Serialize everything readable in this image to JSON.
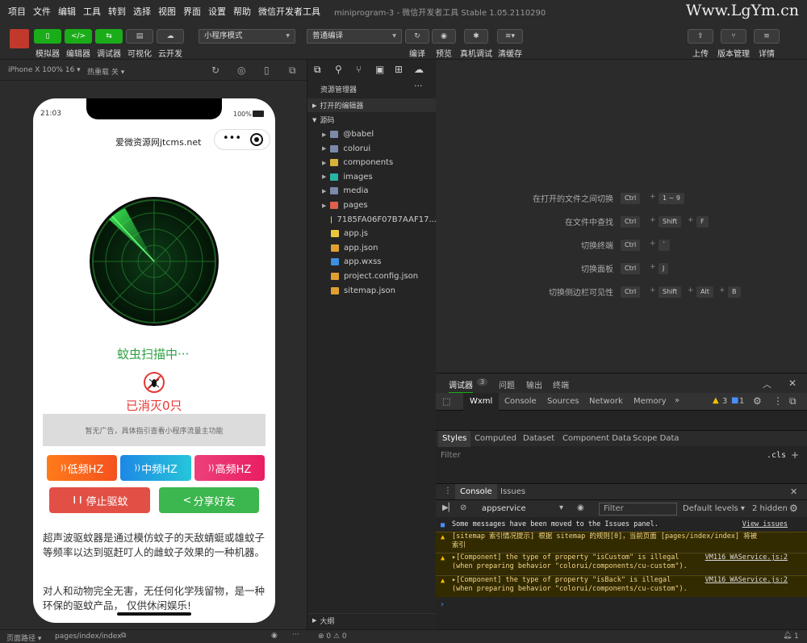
{
  "menu": [
    "项目",
    "文件",
    "编辑",
    "工具",
    "转到",
    "选择",
    "视图",
    "界面",
    "设置",
    "帮助",
    "微信开发者工具"
  ],
  "window_title": "miniprogram-3 - 微信开发者工具 Stable 1.05.2110290",
  "watermark": "Www.LgYm.cn",
  "toolbar": {
    "simulator": "模拟器",
    "editor": "编辑器",
    "debugger": "调试器",
    "visual": "可视化",
    "cloud": "云开发",
    "mode_select": "小程序模式",
    "compile_select": "普通编译",
    "compile": "编译",
    "preview": "预览",
    "real_debug": "真机调试",
    "clear_cache": "清缓存",
    "upload": "上传",
    "version": "版本管理",
    "details": "详情"
  },
  "simbar": {
    "device": "iPhone X 100% 16 ▾",
    "hot_reload": "热重载 关 ▾"
  },
  "phone": {
    "time": "21:03",
    "battery": "100%",
    "nav_title": "爱微资源网jtcms.net",
    "scan_text": "蚊虫扫描中···",
    "killed": "已消灭0只",
    "ad_text": "暂无广告，具体指引查看小程序流量主功能",
    "btn_low": "低频HZ",
    "btn_mid": "中频HZ",
    "btn_high": "高频HZ",
    "btn_stop": "停止驱蚊",
    "btn_share": "分享好友",
    "desc1": "超声波驱蚊器是通过模仿蚊子的天敌蜻蜓或雄蚊子等频率以达到驱赶叮人的雌蚊子效果的一种机器。",
    "desc2": "对人和动物完全无害，无任何化学残留物，是一种环保的驱蚊产品，  仅供休闲娱乐!"
  },
  "explorer": {
    "title": "资源管理器",
    "open_editors": "打开的编辑器",
    "source": "源码",
    "outline": "大纲",
    "items": [
      {
        "name": "@babel",
        "type": "folder"
      },
      {
        "name": "colorui",
        "type": "folder"
      },
      {
        "name": "components",
        "type": "folder-yellow"
      },
      {
        "name": "images",
        "type": "folder-teal"
      },
      {
        "name": "media",
        "type": "folder"
      },
      {
        "name": "pages",
        "type": "folder-red"
      },
      {
        "name": "7185FA06F07B7AAF17...",
        "type": "js"
      },
      {
        "name": "app.js",
        "type": "js"
      },
      {
        "name": "app.json",
        "type": "json"
      },
      {
        "name": "app.wxss",
        "type": "wxss"
      },
      {
        "name": "project.config.json",
        "type": "json"
      },
      {
        "name": "sitemap.json",
        "type": "json"
      }
    ]
  },
  "shortcuts": [
    {
      "label": "在打开的文件之间切换",
      "keys": [
        "Ctrl",
        "1 ~ 9"
      ]
    },
    {
      "label": "在文件中查找",
      "keys": [
        "Ctrl",
        "Shift",
        "F"
      ]
    },
    {
      "label": "切换终端",
      "keys": [
        "Ctrl",
        "`"
      ]
    },
    {
      "label": "切换面板",
      "keys": [
        "Ctrl",
        "J"
      ]
    },
    {
      "label": "切换侧边栏可见性",
      "keys": [
        "Ctrl",
        "Shift",
        "Alt",
        "B"
      ]
    }
  ],
  "debug": {
    "tabs_top": {
      "debugger": "调试器",
      "count": "3",
      "issues": "问题",
      "output": "输出",
      "terminal": "终端"
    },
    "tabs": [
      "Wxml",
      "Console",
      "Sources",
      "Network",
      "Memory"
    ],
    "warn_count": "3",
    "info_count": "1",
    "subtabs": [
      "Styles",
      "Computed",
      "Dataset",
      "Component Data",
      "Scope Data"
    ],
    "filter": "Filter",
    "cls": ".cls",
    "drawer_tabs": [
      "Console",
      "Issues"
    ],
    "context": "appservice",
    "filter2": "Filter",
    "levels": "Default levels ▾",
    "hidden": "2 hidden",
    "messages": [
      {
        "text": "Some messages have been moved to the Issues panel.",
        "link": "View issues",
        "kind": "info"
      },
      {
        "text": "[sitemap 索引情况提示] 根据 sitemap 的规则[0]，当前页面 [pages/index/index] 将被索引",
        "link": "",
        "kind": "warn"
      },
      {
        "text": "▸[Component] the type of property \"isCustom\" is illegal (when preparing behavior \"colorui/components/cu-custom\").",
        "link": "VM116 WAService.js:2",
        "kind": "warn"
      },
      {
        "text": "▸[Component] the type of property \"isBack\" is illegal (when preparing behavior \"colorui/components/cu-custom\").",
        "link": "VM116 WAService.js:2",
        "kind": "warn"
      }
    ]
  },
  "status": {
    "path_label": "页面路径 ▾",
    "path": "pages/index/index",
    "errors": "⊗ 0 ⚠ 0",
    "bell": "1"
  }
}
